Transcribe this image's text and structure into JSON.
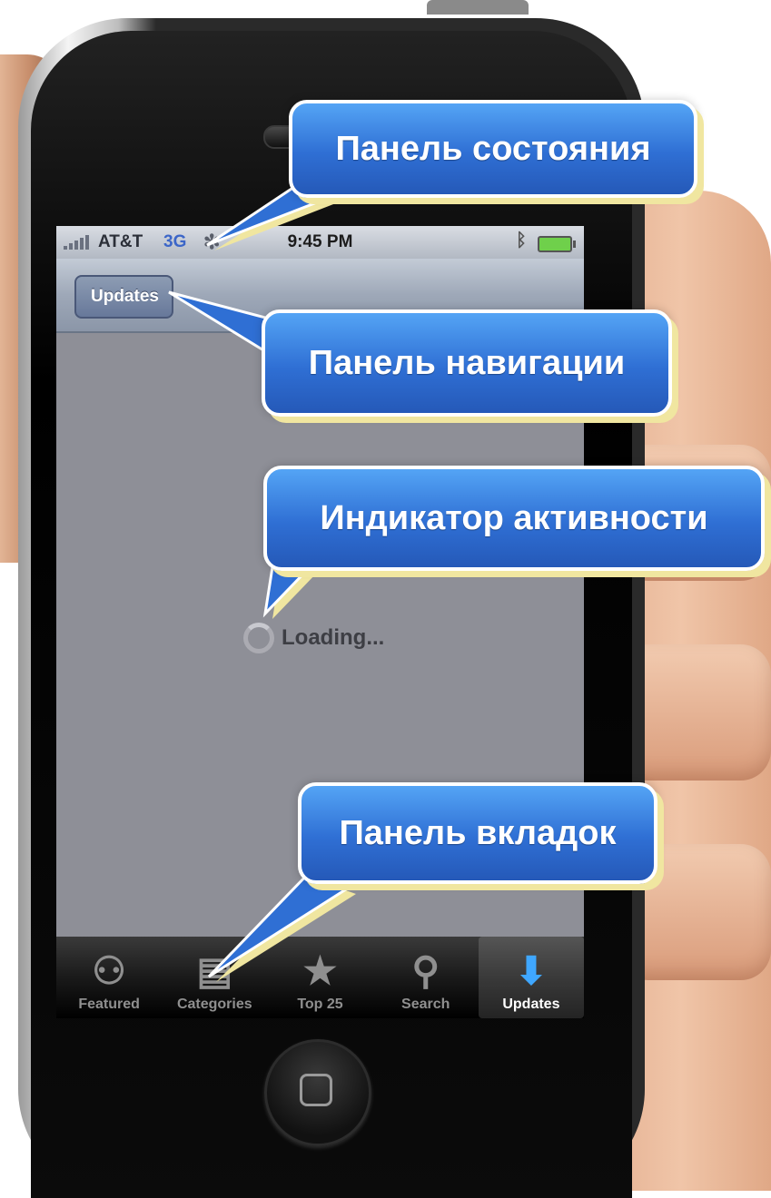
{
  "status_bar": {
    "carrier": "AT&T",
    "network": "3G",
    "time": "9:45 PM",
    "signal_icon": "signal-bars-icon",
    "bluetooth_icon": "bluetooth-icon",
    "battery_icon": "battery-icon"
  },
  "nav_bar": {
    "back_label": "Updates"
  },
  "content": {
    "loading_text": "Loading..."
  },
  "tab_bar": {
    "tabs": [
      {
        "label": "Featured",
        "icon": "featured-icon"
      },
      {
        "label": "Categories",
        "icon": "categories-icon"
      },
      {
        "label": "Top 25",
        "icon": "star-icon"
      },
      {
        "label": "Search",
        "icon": "search-icon"
      },
      {
        "label": "Updates",
        "icon": "download-icon",
        "active": true
      }
    ]
  },
  "callouts": {
    "status_bar": "Панель состояния",
    "nav_bar": "Панель навигации",
    "activity_indicator": "Индикатор активности",
    "tab_bar": "Панель вкладок"
  },
  "colors": {
    "callout_blue": "#2f6fd4",
    "active_tab_icon": "#3fa7ff"
  }
}
